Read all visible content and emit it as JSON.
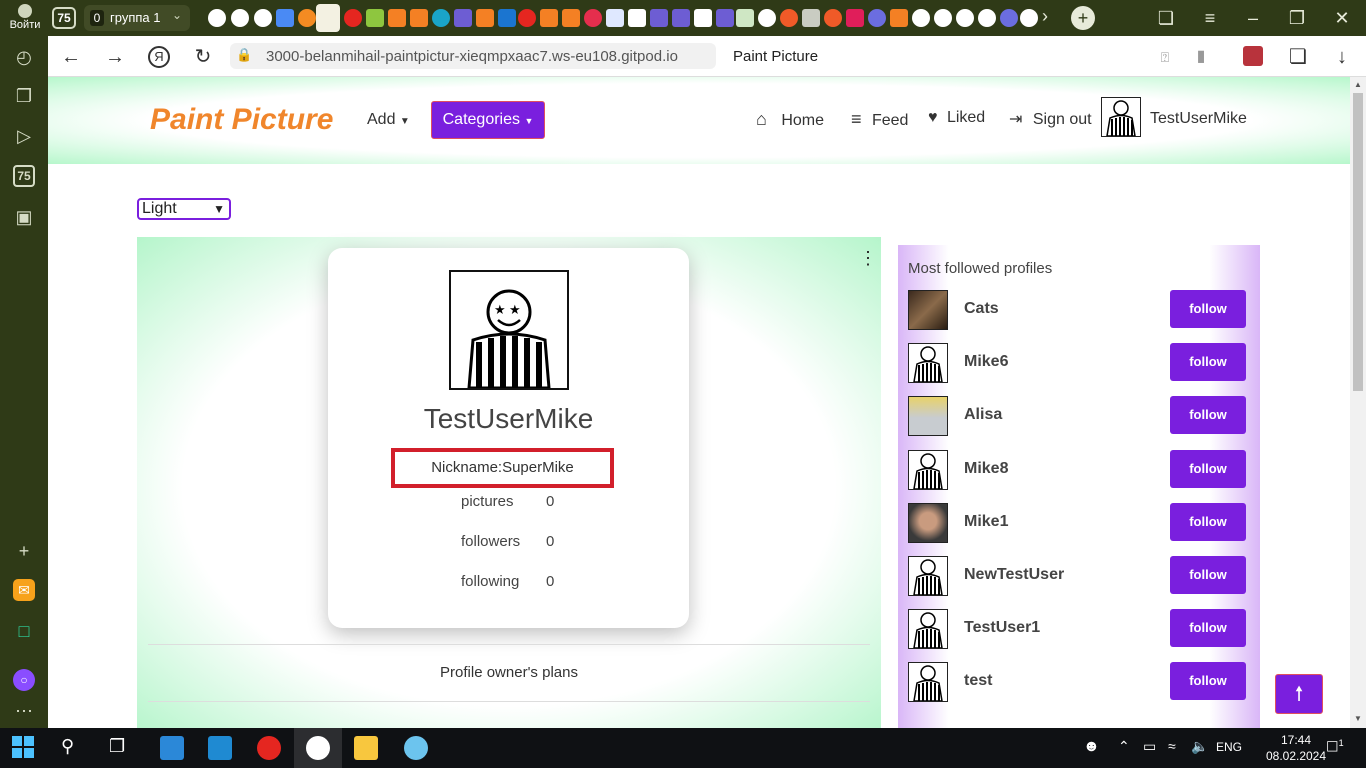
{
  "browser": {
    "login_label": "Войти",
    "tab_count": "75",
    "group_count": "0",
    "group_name": "группа 1",
    "url": "3000-belanmihail-paintpictur-xieqmpxaac7.ws-eu108.gitpod.io",
    "page_title": "Paint Picture",
    "sidebar_count": "75"
  },
  "site": {
    "brand": "Paint Picture",
    "add_label": "Add",
    "categories_label": "Categories",
    "nav": {
      "home": "Home",
      "feed": "Feed",
      "liked": "Liked",
      "sign_out": "Sign out",
      "username": "TestUserMike"
    },
    "theme_value": "Light",
    "profile": {
      "username": "TestUserMike",
      "nickname": "Nickname:SuperMike",
      "stats": [
        {
          "label": "pictures",
          "value": "0"
        },
        {
          "label": "followers",
          "value": "0"
        },
        {
          "label": "following",
          "value": "0"
        }
      ],
      "plans_label": "Profile owner's plans"
    },
    "followed": {
      "title": "Most followed profiles",
      "button_label": "follow",
      "profiles": [
        {
          "name": "Cats",
          "avatar": "cat-photo"
        },
        {
          "name": "Mike6",
          "avatar": "striped-smiley"
        },
        {
          "name": "Alisa",
          "avatar": "alisa-badge"
        },
        {
          "name": "Mike8",
          "avatar": "striped-smiley"
        },
        {
          "name": "Mike1",
          "avatar": "face-photo"
        },
        {
          "name": "NewTestUser",
          "avatar": "striped-smiley"
        },
        {
          "name": "TestUser1",
          "avatar": "striped-smiley"
        },
        {
          "name": "test",
          "avatar": "striped-smiley"
        }
      ]
    }
  },
  "taskbar": {
    "lang": "ENG",
    "time": "17:44",
    "date": "08.02.2024",
    "notifications": "1"
  },
  "colors": {
    "accent": "#7a1fde",
    "brand": "#f0862c",
    "highlight": "#d21f2b",
    "chrome": "#2f3a17"
  }
}
